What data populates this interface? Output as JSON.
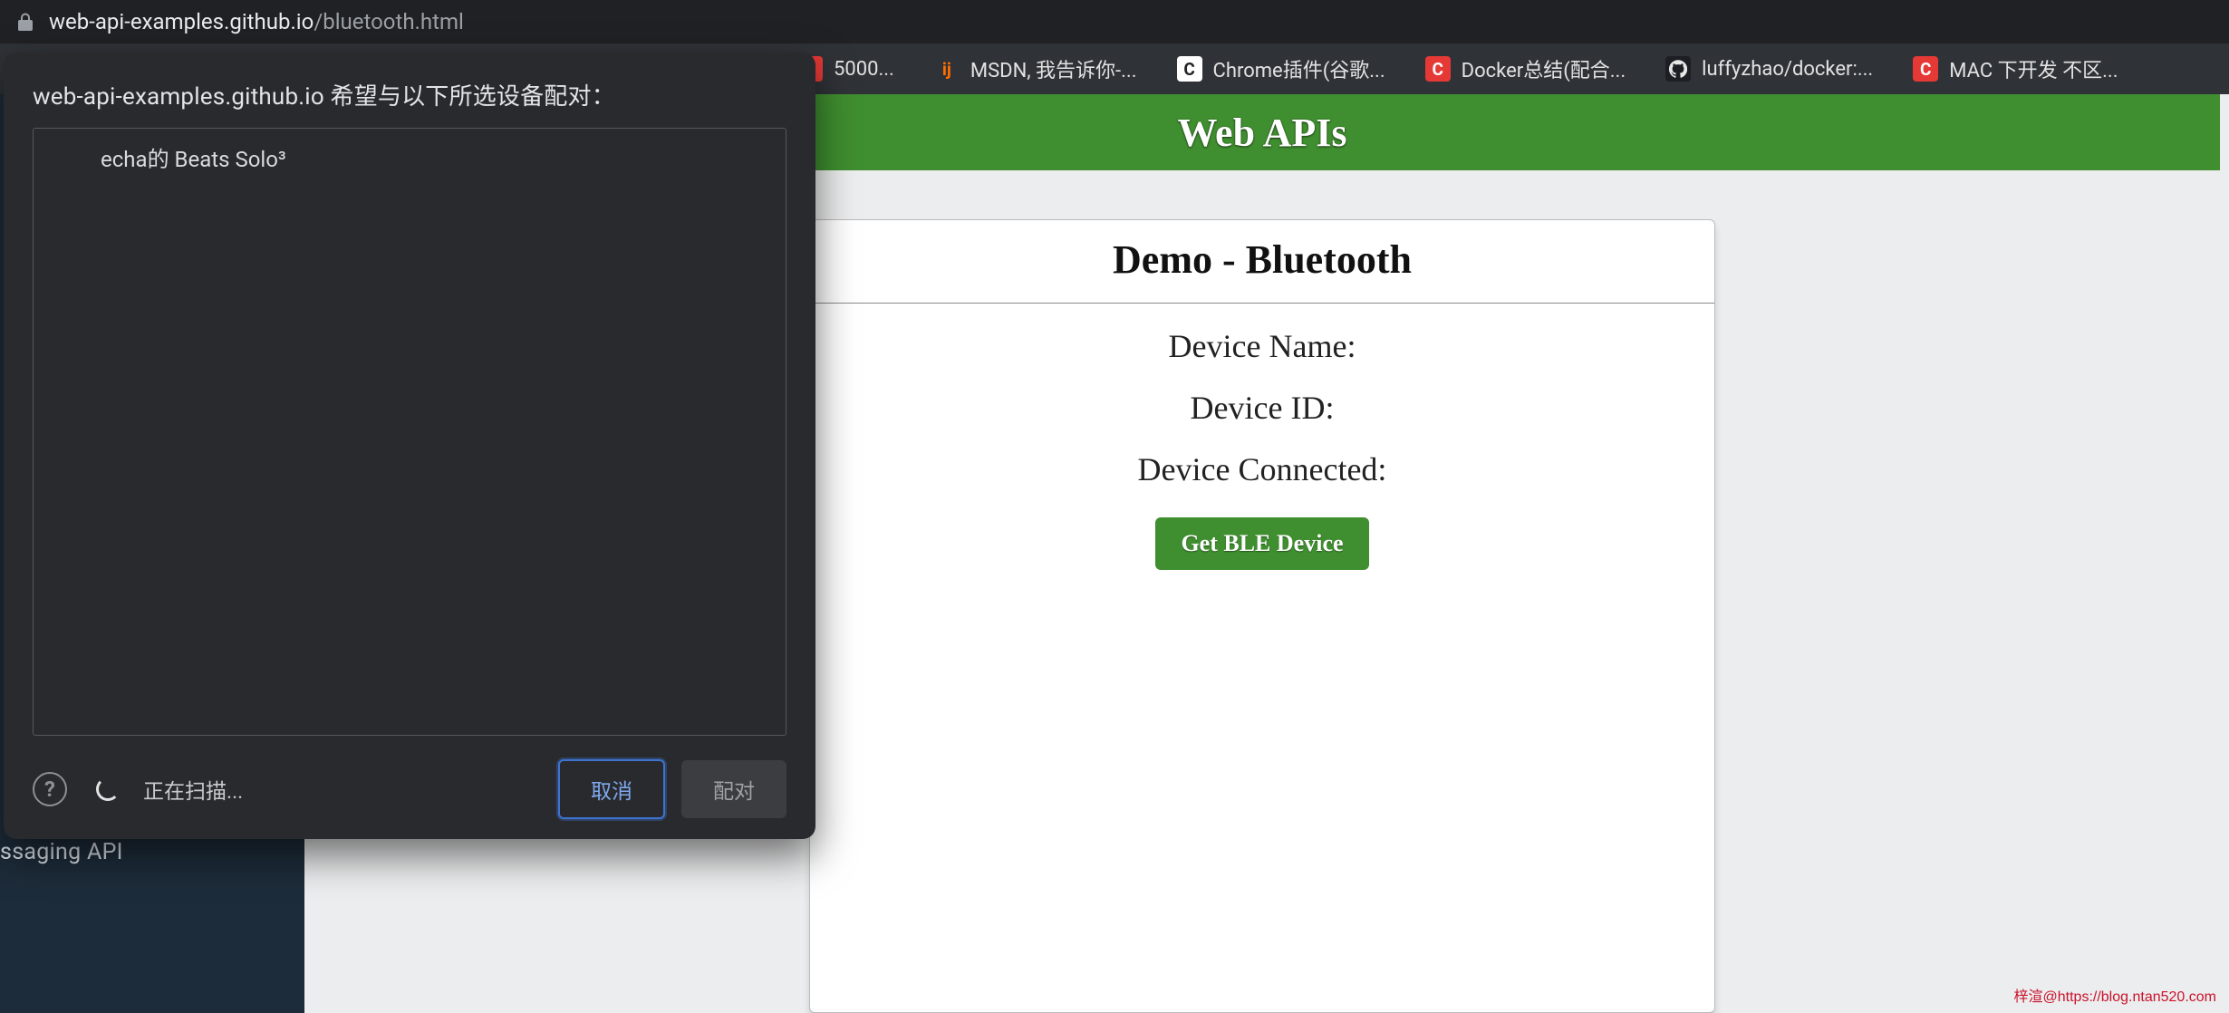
{
  "address_bar": {
    "host": "web-api-examples.github.io",
    "path": "/bluetooth.html"
  },
  "bookmarks": [
    {
      "label": "5000...",
      "icon": "5000-icon",
      "favicon_class": "fav-red"
    },
    {
      "label": "MSDN, 我告诉你-...",
      "icon": "msdn-icon",
      "favicon_class": "fav-orange",
      "glyph": "ij"
    },
    {
      "label": "Chrome插件(谷歌...",
      "icon": "chrome-icon",
      "favicon_class": "fav-white",
      "glyph": "C"
    },
    {
      "label": "Docker总结(配合...",
      "icon": "docker-icon",
      "favicon_class": "fav-red",
      "glyph": "C"
    },
    {
      "label": "luffyzhao/docker:...",
      "icon": "github-icon",
      "favicon_class": "fav-dark",
      "glyph": ""
    },
    {
      "label": "MAC 下开发 不区...",
      "icon": "mac-icon",
      "favicon_class": "fav-red",
      "glyph": "C"
    }
  ],
  "sidebar": {
    "item0": "ssaging API"
  },
  "header": {
    "title": "Web APIs"
  },
  "card": {
    "title": "Demo - Bluetooth",
    "line1": "Device Name:",
    "line2": "Device ID:",
    "line3": "Device Connected:",
    "button": "Get BLE Device"
  },
  "dialog": {
    "prompt": "web-api-examples.github.io 希望与以下所选设备配对：",
    "devices": [
      "echa的 Beats Solo³"
    ],
    "scanning": "正在扫描...",
    "cancel": "取消",
    "pair": "配对"
  },
  "watermark": "梓渲@https://blog.ntan520.com"
}
